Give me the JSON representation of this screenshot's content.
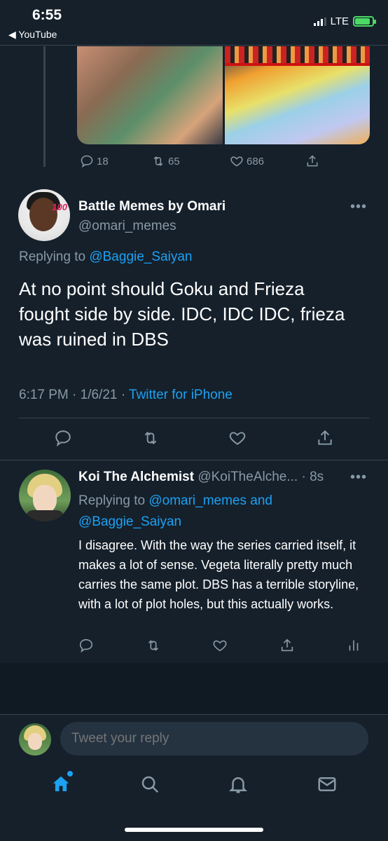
{
  "status_bar": {
    "time": "6:55",
    "back_app": "◀ YouTube",
    "network": "LTE"
  },
  "prev_tweet": {
    "actions": {
      "replies": "18",
      "retweets": "65",
      "likes": "686"
    }
  },
  "main_tweet": {
    "name": "Battle Memes by Omari",
    "handle": "@omari_memes",
    "replying_prefix": "Replying to ",
    "replying_to": "@Baggie_Saiyan",
    "text": "At no point should Goku and Frieza fought side by side. IDC, IDC IDC, frieza was ruined in DBS",
    "time": "6:17 PM · 1/6/21 · ",
    "source": "Twitter for iPhone",
    "more": "•••"
  },
  "reply_tweet": {
    "name": "Koi The Alchemist",
    "handle_time": "@KoiTheAlche... · 8s",
    "replying_prefix": "Replying to ",
    "replying_user1": "@omari_memes",
    "replying_and": " and",
    "replying_user2": "@Baggie_Saiyan",
    "text": "I disagree. With the way the series carried itself, it makes a lot of sense. Vegeta literally pretty much carries the same plot. DBS has a terrible storyline, with a lot of plot holes, but this actually works.",
    "more": "•••"
  },
  "compose": {
    "placeholder": "Tweet your reply"
  },
  "colors": {
    "background": "#15202b",
    "accent": "#1da1f2",
    "muted": "#8899a6",
    "divider": "#38444d"
  },
  "icons": [
    "reply-icon",
    "retweet-icon",
    "like-icon",
    "share-icon",
    "analytics-icon",
    "home-icon",
    "search-icon",
    "notifications-icon",
    "messages-icon"
  ]
}
